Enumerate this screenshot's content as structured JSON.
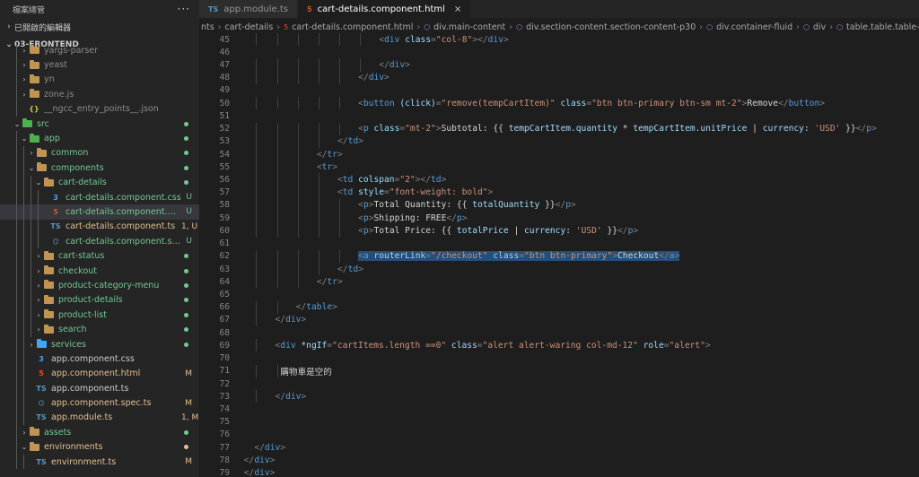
{
  "sidebar": {
    "header_title": "檔案總管",
    "header_more": "···",
    "open_editors": "已開啟的編輯器",
    "project": "03-FRONTEND",
    "tree": [
      {
        "label": "yargs-parser",
        "type": "folder",
        "depth": 1,
        "chev": "›",
        "color": "muted"
      },
      {
        "label": "yeast",
        "type": "folder",
        "depth": 1,
        "chev": "›",
        "color": "muted"
      },
      {
        "label": "yn",
        "type": "folder",
        "depth": 1,
        "chev": "›",
        "color": "muted"
      },
      {
        "label": "zone.js",
        "type": "folder",
        "depth": 1,
        "chev": "›",
        "color": "muted"
      },
      {
        "label": "__ngcc_entry_points__.json",
        "type": "json",
        "depth": 1,
        "chev": "",
        "color": "muted"
      },
      {
        "label": "src",
        "type": "folder-src",
        "depth": 0,
        "chev": "⌄",
        "color": "green",
        "dot": "#73c991"
      },
      {
        "label": "app",
        "type": "folder-app",
        "depth": 1,
        "chev": "⌄",
        "color": "green",
        "dot": "#73c991"
      },
      {
        "label": "common",
        "type": "folder",
        "depth": 2,
        "chev": "›",
        "color": "green",
        "dot": "#73c991"
      },
      {
        "label": "components",
        "type": "folder-cmp",
        "depth": 2,
        "chev": "⌄",
        "color": "green",
        "dot": "#73c991"
      },
      {
        "label": "cart-details",
        "type": "folder",
        "depth": 3,
        "chev": "⌄",
        "color": "green",
        "dot": "#73c991"
      },
      {
        "label": "cart-details.component.css",
        "type": "css",
        "depth": 4,
        "chev": "",
        "color": "green",
        "badge": "U"
      },
      {
        "label": "cart-details.component.html",
        "type": "html",
        "depth": 4,
        "chev": "",
        "color": "green",
        "badge": "U",
        "selected": true
      },
      {
        "label": "cart-details.component.ts",
        "type": "ts",
        "depth": 4,
        "chev": "",
        "color": "olive",
        "badge": "1, U"
      },
      {
        "label": "cart-details.component.spec.ts",
        "type": "spec",
        "depth": 4,
        "chev": "",
        "color": "green",
        "badge": "U"
      },
      {
        "label": "cart-status",
        "type": "folder",
        "depth": 3,
        "chev": "›",
        "color": "green",
        "dot": "#73c991"
      },
      {
        "label": "checkout",
        "type": "folder",
        "depth": 3,
        "chev": "›",
        "color": "green",
        "dot": "#73c991"
      },
      {
        "label": "product-category-menu",
        "type": "folder",
        "depth": 3,
        "chev": "›",
        "color": "green",
        "dot": "#73c991"
      },
      {
        "label": "product-details",
        "type": "folder",
        "depth": 3,
        "chev": "›",
        "color": "green",
        "dot": "#73c991"
      },
      {
        "label": "product-list",
        "type": "folder",
        "depth": 3,
        "chev": "›",
        "color": "green",
        "dot": "#73c991"
      },
      {
        "label": "search",
        "type": "folder",
        "depth": 3,
        "chev": "›",
        "color": "green",
        "dot": "#73c991"
      },
      {
        "label": "services",
        "type": "folder-srv",
        "depth": 2,
        "chev": "›",
        "color": "green",
        "dot": "#73c991"
      },
      {
        "label": "app.component.css",
        "type": "css",
        "depth": 2,
        "chev": "",
        "color": "plain"
      },
      {
        "label": "app.component.html",
        "type": "html",
        "depth": 2,
        "chev": "",
        "color": "olive",
        "badge": "M"
      },
      {
        "label": "app.component.ts",
        "type": "ts",
        "depth": 2,
        "chev": "",
        "color": "plain"
      },
      {
        "label": "app.component.spec.ts",
        "type": "spec",
        "depth": 2,
        "chev": "",
        "color": "olive",
        "badge": "M"
      },
      {
        "label": "app.module.ts",
        "type": "ts",
        "depth": 2,
        "chev": "",
        "color": "olive",
        "badge": "1, M"
      },
      {
        "label": "assets",
        "type": "folder-ast",
        "depth": 1,
        "chev": "›",
        "color": "green",
        "dot": "#73c991"
      },
      {
        "label": "environments",
        "type": "folder-env",
        "depth": 1,
        "chev": "⌄",
        "color": "olive",
        "dot": "#e2c08d"
      },
      {
        "label": "environment.ts",
        "type": "ts",
        "depth": 2,
        "chev": "",
        "color": "olive",
        "badge": "M"
      }
    ]
  },
  "tabs": [
    {
      "label": "app.module.ts",
      "icon": "TS",
      "icon_color": "#519aba",
      "active": false
    },
    {
      "label": "cart-details.component.html",
      "icon": "5",
      "icon_color": "#e44d26",
      "active": true
    }
  ],
  "breadcrumbs": [
    {
      "label": "nts",
      "icon": ""
    },
    {
      "label": "cart-details",
      "icon": ""
    },
    {
      "label": "cart-details.component.html",
      "icon": "5"
    },
    {
      "label": "div.main-content",
      "icon": "⬡"
    },
    {
      "label": "div.section-content.section-content-p30",
      "icon": "⬡"
    },
    {
      "label": "div.container-fluid",
      "icon": "⬡"
    },
    {
      "label": "div",
      "icon": "⬡"
    },
    {
      "label": "table.table.table-borde",
      "icon": "⬡"
    }
  ],
  "code_lines": [
    {
      "n": "45",
      "indent": 27,
      "tokens": [
        [
          "p",
          "<"
        ],
        [
          "t",
          "div"
        ],
        [
          "a",
          " class"
        ],
        [
          "p",
          "="
        ],
        [
          "s",
          "\"col-8\""
        ],
        [
          "p",
          "></"
        ],
        [
          "t",
          "div"
        ],
        [
          "p",
          ">"
        ]
      ]
    },
    {
      "n": "46",
      "indent": 0,
      "tokens": []
    },
    {
      "n": "47",
      "indent": 27,
      "tokens": [
        [
          "p",
          "</"
        ],
        [
          "t",
          "div"
        ],
        [
          "p",
          ">"
        ]
      ]
    },
    {
      "n": "48",
      "indent": 23,
      "tokens": [
        [
          "p",
          "</"
        ],
        [
          "t",
          "div"
        ],
        [
          "p",
          ">"
        ]
      ]
    },
    {
      "n": "49",
      "indent": 0,
      "tokens": []
    },
    {
      "n": "50",
      "indent": 23,
      "tokens": [
        [
          "p",
          "<"
        ],
        [
          "t",
          "button"
        ],
        [
          "a",
          " (click)"
        ],
        [
          "p",
          "="
        ],
        [
          "s",
          "\"remove(tempCartItem)\""
        ],
        [
          "a",
          " class"
        ],
        [
          "p",
          "="
        ],
        [
          "s",
          "\"btn btn-primary btn-sm mt-2\""
        ],
        [
          "p",
          ">"
        ],
        [
          "x",
          "Remove"
        ],
        [
          "p",
          "</"
        ],
        [
          "t",
          "button"
        ],
        [
          "p",
          ">"
        ]
      ]
    },
    {
      "n": "51",
      "indent": 0,
      "tokens": []
    },
    {
      "n": "52",
      "indent": 23,
      "tokens": [
        [
          "p",
          "<"
        ],
        [
          "t",
          "p"
        ],
        [
          "a",
          " class"
        ],
        [
          "p",
          "="
        ],
        [
          "s",
          "\"mt-2\""
        ],
        [
          "p",
          ">"
        ],
        [
          "x",
          "Subtotal: {{ "
        ],
        [
          "e",
          "tempCartItem.quantity"
        ],
        [
          "x",
          " * "
        ],
        [
          "e",
          "tempCartItem.unitPrice"
        ],
        [
          "x",
          " | "
        ],
        [
          "e",
          "currency"
        ],
        [
          "x",
          ": "
        ],
        [
          "s",
          "'USD'"
        ],
        [
          "x",
          " }}"
        ],
        [
          "p",
          "</"
        ],
        [
          "t",
          "p"
        ],
        [
          "p",
          ">"
        ]
      ]
    },
    {
      "n": "53",
      "indent": 19,
      "tokens": [
        [
          "p",
          "</"
        ],
        [
          "t",
          "td"
        ],
        [
          "p",
          ">"
        ]
      ]
    },
    {
      "n": "54",
      "indent": 15,
      "tokens": [
        [
          "p",
          "</"
        ],
        [
          "t",
          "tr"
        ],
        [
          "p",
          ">"
        ]
      ]
    },
    {
      "n": "55",
      "indent": 15,
      "tokens": [
        [
          "p",
          "<"
        ],
        [
          "t",
          "tr"
        ],
        [
          "p",
          ">"
        ]
      ]
    },
    {
      "n": "56",
      "indent": 19,
      "tokens": [
        [
          "p",
          "<"
        ],
        [
          "t",
          "td"
        ],
        [
          "a",
          " colspan"
        ],
        [
          "p",
          "="
        ],
        [
          "s",
          "\"2\""
        ],
        [
          "p",
          "></"
        ],
        [
          "t",
          "td"
        ],
        [
          "p",
          ">"
        ]
      ]
    },
    {
      "n": "57",
      "indent": 19,
      "tokens": [
        [
          "p",
          "<"
        ],
        [
          "t",
          "td"
        ],
        [
          "a",
          " style"
        ],
        [
          "p",
          "="
        ],
        [
          "s",
          "\"font-weight: bold\""
        ],
        [
          "p",
          ">"
        ]
      ]
    },
    {
      "n": "58",
      "indent": 23,
      "tokens": [
        [
          "p",
          "<"
        ],
        [
          "t",
          "p"
        ],
        [
          "p",
          ">"
        ],
        [
          "x",
          "Total Quantity: {{ "
        ],
        [
          "e",
          "totalQuantity"
        ],
        [
          "x",
          " }}"
        ],
        [
          "p",
          "</"
        ],
        [
          "t",
          "p"
        ],
        [
          "p",
          ">"
        ]
      ]
    },
    {
      "n": "59",
      "indent": 23,
      "tokens": [
        [
          "p",
          "<"
        ],
        [
          "t",
          "p"
        ],
        [
          "p",
          ">"
        ],
        [
          "x",
          "Shipping: FREE"
        ],
        [
          "p",
          "</"
        ],
        [
          "t",
          "p"
        ],
        [
          "p",
          ">"
        ]
      ]
    },
    {
      "n": "60",
      "indent": 23,
      "tokens": [
        [
          "p",
          "<"
        ],
        [
          "t",
          "p"
        ],
        [
          "p",
          ">"
        ],
        [
          "x",
          "Total Price: {{ "
        ],
        [
          "e",
          "totalPrice"
        ],
        [
          "x",
          " | "
        ],
        [
          "e",
          "currency"
        ],
        [
          "x",
          ": "
        ],
        [
          "s",
          "'USD'"
        ],
        [
          "x",
          " }}"
        ],
        [
          "p",
          "</"
        ],
        [
          "t",
          "p"
        ],
        [
          "p",
          ">"
        ]
      ]
    },
    {
      "n": "61",
      "indent": 0,
      "tokens": []
    },
    {
      "n": "62",
      "indent": 23,
      "sel": true,
      "tokens": [
        [
          "p",
          "<"
        ],
        [
          "t",
          "a"
        ],
        [
          "a",
          " routerLink"
        ],
        [
          "p",
          "="
        ],
        [
          "s",
          "\"/checkout\""
        ],
        [
          "a",
          " class"
        ],
        [
          "p",
          "="
        ],
        [
          "s",
          "\"btn btn-primary\""
        ],
        [
          "p",
          ">"
        ],
        [
          "x",
          "Checkout"
        ],
        [
          "p",
          "</"
        ],
        [
          "t",
          "a"
        ],
        [
          "p",
          ">"
        ]
      ]
    },
    {
      "n": "63",
      "indent": 19,
      "tokens": [
        [
          "p",
          "</"
        ],
        [
          "t",
          "td"
        ],
        [
          "p",
          ">"
        ]
      ]
    },
    {
      "n": "64",
      "indent": 15,
      "tokens": [
        [
          "p",
          "</"
        ],
        [
          "t",
          "tr"
        ],
        [
          "p",
          ">"
        ]
      ]
    },
    {
      "n": "65",
      "indent": 0,
      "tokens": []
    },
    {
      "n": "66",
      "indent": 11,
      "tokens": [
        [
          "p",
          "</"
        ],
        [
          "t",
          "table"
        ],
        [
          "p",
          ">"
        ]
      ]
    },
    {
      "n": "67",
      "indent": 7,
      "tokens": [
        [
          "p",
          "</"
        ],
        [
          "t",
          "div"
        ],
        [
          "p",
          ">"
        ]
      ]
    },
    {
      "n": "68",
      "indent": 0,
      "tokens": []
    },
    {
      "n": "69",
      "indent": 7,
      "tokens": [
        [
          "p",
          "<"
        ],
        [
          "t",
          "div"
        ],
        [
          "a",
          " *ngIf"
        ],
        [
          "p",
          "="
        ],
        [
          "s",
          "\"cartItems.length ==0\""
        ],
        [
          "a",
          " class"
        ],
        [
          "p",
          "="
        ],
        [
          "s",
          "\"alert alert-waring col-md-12\""
        ],
        [
          "a",
          " role"
        ],
        [
          "p",
          "="
        ],
        [
          "s",
          "\"alert\""
        ],
        [
          "p",
          ">"
        ]
      ]
    },
    {
      "n": "70",
      "indent": 0,
      "tokens": []
    },
    {
      "n": "71",
      "indent": 8,
      "tokens": [
        [
          "x",
          "購物車是空的"
        ]
      ]
    },
    {
      "n": "72",
      "indent": 0,
      "tokens": []
    },
    {
      "n": "73",
      "indent": 7,
      "tokens": [
        [
          "p",
          "</"
        ],
        [
          "t",
          "div"
        ],
        [
          "p",
          ">"
        ]
      ]
    },
    {
      "n": "74",
      "indent": 0,
      "tokens": []
    },
    {
      "n": "75",
      "indent": 0,
      "tokens": []
    },
    {
      "n": "76",
      "indent": 0,
      "tokens": []
    },
    {
      "n": "77",
      "indent": 3,
      "tokens": [
        [
          "p",
          "</"
        ],
        [
          "t",
          "div"
        ],
        [
          "p",
          ">"
        ]
      ]
    },
    {
      "n": "78",
      "indent": 1,
      "tokens": [
        [
          "p",
          "</"
        ],
        [
          "t",
          "div"
        ],
        [
          "p",
          ">"
        ]
      ]
    },
    {
      "n": "79",
      "indent": 1,
      "tokens": [
        [
          "p",
          "</"
        ],
        [
          "t",
          "div"
        ],
        [
          "p",
          ">"
        ]
      ]
    }
  ],
  "colors": {
    "sidebar_bg": "#252526",
    "editor_bg": "#1e1e1e",
    "selection": "#264f78",
    "git_untracked": "#73c991",
    "git_modified": "#e2c08d"
  }
}
